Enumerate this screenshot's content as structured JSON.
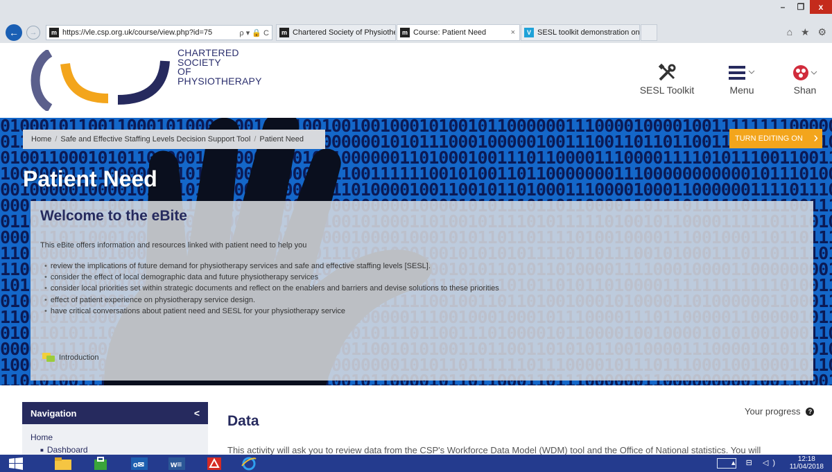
{
  "browser": {
    "url": "https://vle.csp.org.uk/course/view.php?id=75",
    "tabs": [
      {
        "label": "Chartered Society of Physiothe...",
        "favicon": "m-icon",
        "active": false
      },
      {
        "label": "Course: Patient Need",
        "favicon": "m-icon",
        "active": true,
        "close": "×"
      },
      {
        "label": "SESL toolkit demonstration on ...",
        "favicon": "v-icon",
        "active": false
      }
    ],
    "address_tools": "ρ ▾ 🔒 C",
    "window_buttons": {
      "minimize": "–",
      "restore": "❐",
      "close": "x"
    },
    "toolbar_icons": "⌂ ★ ⚙"
  },
  "site": {
    "org_name": [
      "CHARTERED",
      "SOCIETY",
      "OF",
      "PHYSIOTHERAPY"
    ],
    "header_items": {
      "toolkit": "SESL Toolkit",
      "menu": "Menu",
      "user": "Shan"
    }
  },
  "hero": {
    "breadcrumb": [
      "Home",
      "Safe and Effective Staffing Levels Decision Support Tool",
      "Patient Need"
    ],
    "breadcrumb_sep": "/",
    "edit_button": "TURN EDITING ON",
    "page_title": "Patient Need"
  },
  "welcome": {
    "title": "Welcome to the eBite",
    "intro": "This eBite offers information and resources linked with patient need to help you",
    "bullets": [
      "review the implications of future demand for physiotherapy services and safe and effective staffing levels [SESL].",
      "consider the effect of local demographic data and future physiotherapy services",
      "consider local priorities set within strategic documents and reflect on the enablers and barriers and devise solutions to these priorities",
      "effect of patient experience on physiotherapy service design.",
      "have critical conversations about patient need and SESL for your physiotherapy service"
    ],
    "intro_link": "Introduction"
  },
  "navigation": {
    "title": "Navigation",
    "collapse": "<",
    "home": "Home",
    "dashboard": "Dashboard"
  },
  "section": {
    "title": "Data",
    "progress_label": "Your progress",
    "progress_help": "?",
    "description": "This activity will ask you to review data from the CSP's Workforce Data Model (WDM) tool and the Office of National statistics. You will"
  },
  "taskbar": {
    "time": "12:18",
    "date": "11/04/2018"
  },
  "colors": {
    "brand_navy": "#262a5e",
    "brand_orange": "#f3a51c",
    "hero_blue": "#1467c9",
    "taskbar": "#243b8e"
  }
}
